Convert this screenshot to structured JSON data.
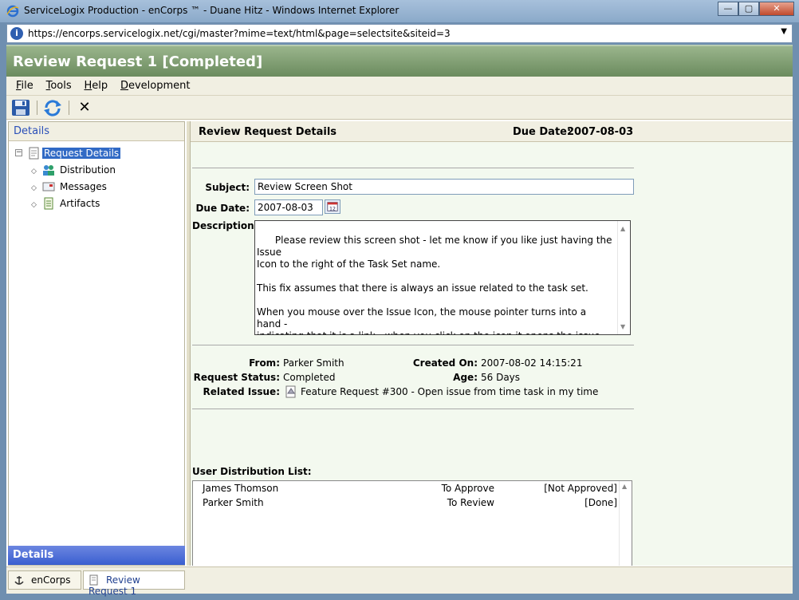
{
  "window": {
    "title": "ServiceLogix Production - enCorps ™ - Duane Hitz - Windows Internet Explorer",
    "buttons": {
      "minimize": "—",
      "maximize": "▢",
      "close": "✕"
    }
  },
  "address": {
    "url": "https://encorps.servicelogix.net/cgi/master?mime=text/html&page=selectsite&siteid=3"
  },
  "app": {
    "title": "Review Request 1 [Completed]"
  },
  "menu": {
    "items": [
      {
        "acc": "F",
        "rest": "ile"
      },
      {
        "acc": "T",
        "rest": "ools"
      },
      {
        "acc": "H",
        "rest": "elp"
      },
      {
        "acc": "D",
        "rest": "evelopment"
      }
    ]
  },
  "toolbar": {
    "delete_glyph": "✕"
  },
  "left": {
    "header": "Details",
    "tree": {
      "root": "Request Details",
      "children": [
        "Distribution",
        "Messages",
        "Artifacts"
      ]
    },
    "footer": "Details"
  },
  "right": {
    "header": {
      "title": "Review Request Details",
      "due_label": "Due Date:",
      "due_value": "2007-08-03"
    },
    "form": {
      "subject_label": "Subject:",
      "subject_value": "Review Screen Shot",
      "due_label": "Due Date:",
      "due_value": "2007-08-03",
      "description_label": "Description:",
      "description_value": "Please review this screen shot - let me know if you like just having the Issue\nIcon to the right of the Task Set name.\n\nThis fix assumes that there is always an issue related to the task set.\n\nWhen you mouse over the Issue Icon, the mouse pointer turns into a hand -\nindicating that it is a link - when you click on the icon it opens the issue."
    },
    "info": {
      "from_label": "From:",
      "from_value": "Parker Smith",
      "created_label": "Created On:",
      "created_value": "2007-08-02 14:15:21",
      "status_label": "Request Status:",
      "status_value": "Completed",
      "age_label": "Age:",
      "age_value": "56 Days",
      "issue_label": "Related Issue:",
      "issue_value": "Feature Request #300 - Open issue from time task in my time"
    },
    "distribution": {
      "title": "User Distribution List:",
      "rows": [
        {
          "name": "James Thomson",
          "role": "To Approve",
          "status": "[Not Approved]"
        },
        {
          "name": "Parker Smith",
          "role": "To Review",
          "status": "[Done]"
        }
      ]
    }
  },
  "tabs": [
    {
      "label": "enCorps"
    },
    {
      "label": "Review Request 1"
    }
  ]
}
